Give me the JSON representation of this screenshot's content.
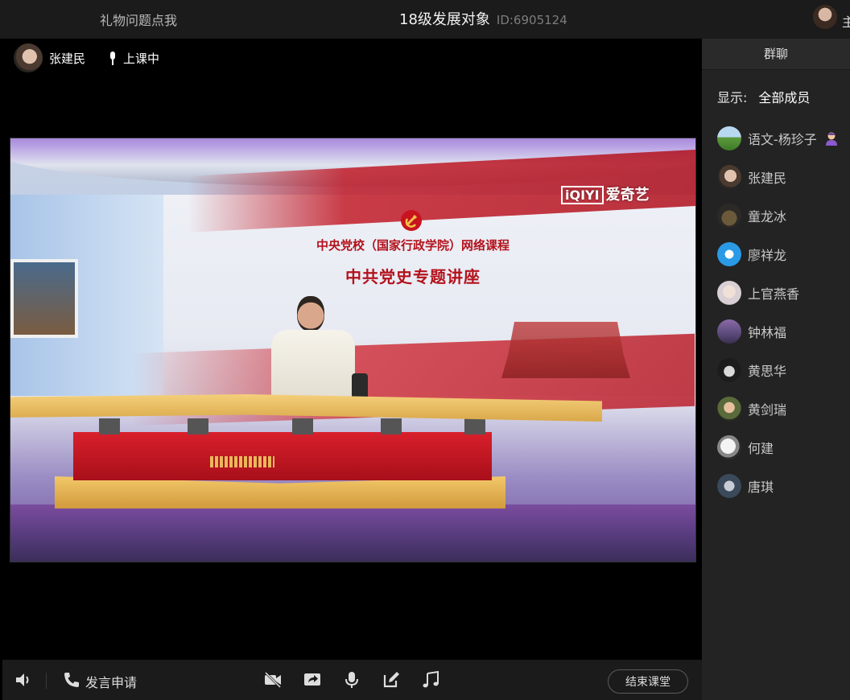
{
  "header": {
    "gift_link": "礼物问题点我",
    "title": "18级发展对象",
    "room_id": "ID:6905124",
    "user_cut": "主"
  },
  "host": {
    "name": "张建民",
    "status": "上课中"
  },
  "video": {
    "line1": "中央党校（国家行政学院）网络课程",
    "line2": "中共党史专题讲座",
    "logo_box": "iQIYI",
    "logo_text": "爱奇艺"
  },
  "controls": {
    "apply_label": "发言申请",
    "end_label": "结束课堂"
  },
  "sidebar": {
    "tab": "群聊",
    "filter_label": "显示:",
    "filter_value": "全部成员",
    "members": [
      {
        "name": "语文-杨珍子"
      },
      {
        "name": "张建民"
      },
      {
        "name": "童龙冰"
      },
      {
        "name": "廖祥龙"
      },
      {
        "name": "上官燕香"
      },
      {
        "name": "钟林福"
      },
      {
        "name": "黄思华"
      },
      {
        "name": "黄剑瑞"
      },
      {
        "name": "何建"
      },
      {
        "name": "唐琪"
      }
    ]
  }
}
